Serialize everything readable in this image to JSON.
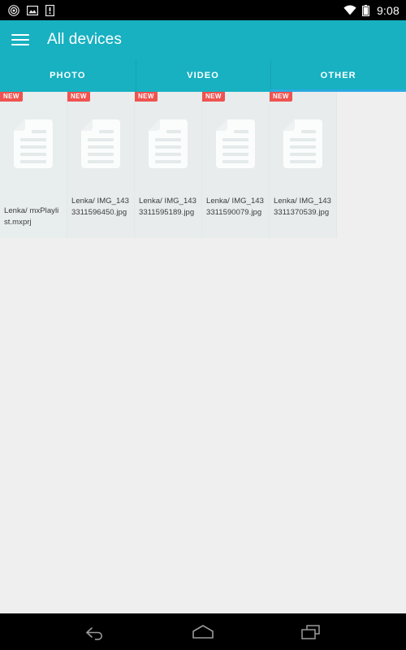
{
  "statusbar": {
    "time": "9:08",
    "left_icons": [
      "record-circle-icon",
      "photo-icon",
      "alert-box-icon"
    ],
    "right_icons": [
      "wifi-icon",
      "battery-icon"
    ],
    "background": "#000000"
  },
  "appbar": {
    "menu_icon": "hamburger-menu-icon",
    "title": "All devices",
    "background": "#17b1c1"
  },
  "tabs": {
    "items": [
      {
        "label": "PHOTO",
        "selected": false
      },
      {
        "label": "VIDEO",
        "selected": false
      },
      {
        "label": "OTHER",
        "selected": true
      }
    ],
    "indicator_color": "#2aa9e0"
  },
  "files": {
    "badge_label": "NEW",
    "badge_color": "#ef5350",
    "items": [
      {
        "name": "Lenka/\nmxPlaylist.mxprj",
        "badge": "NEW",
        "icon": "document-icon"
      },
      {
        "name": "Lenka/\nIMG_1433311596450.jpg",
        "badge": "NEW",
        "icon": "document-icon"
      },
      {
        "name": "Lenka/\nIMG_1433311595189.jpg",
        "badge": "NEW",
        "icon": "document-icon"
      },
      {
        "name": "Lenka/\nIMG_1433311590079.jpg",
        "badge": "NEW",
        "icon": "document-icon"
      },
      {
        "name": "Lenka/\nIMG_1433311370539.jpg",
        "badge": "NEW",
        "icon": "document-icon"
      }
    ]
  },
  "navbar": {
    "back": "back-icon",
    "home": "home-icon",
    "recents": "recents-icon",
    "background": "#000000"
  }
}
